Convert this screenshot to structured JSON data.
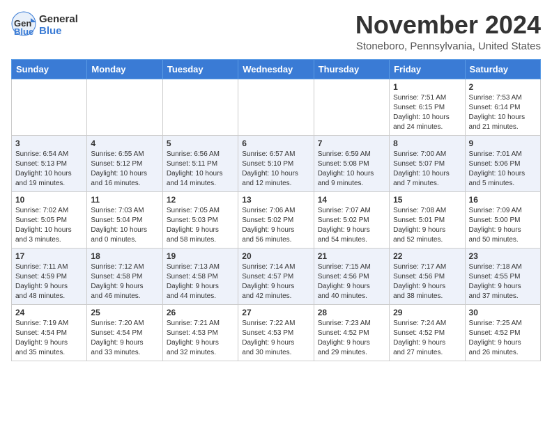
{
  "header": {
    "logo_line1": "General",
    "logo_line2": "Blue",
    "month_title": "November 2024",
    "location": "Stoneboro, Pennsylvania, United States"
  },
  "weekdays": [
    "Sunday",
    "Monday",
    "Tuesday",
    "Wednesday",
    "Thursday",
    "Friday",
    "Saturday"
  ],
  "weeks": [
    [
      {
        "day": "",
        "info": ""
      },
      {
        "day": "",
        "info": ""
      },
      {
        "day": "",
        "info": ""
      },
      {
        "day": "",
        "info": ""
      },
      {
        "day": "",
        "info": ""
      },
      {
        "day": "1",
        "info": "Sunrise: 7:51 AM\nSunset: 6:15 PM\nDaylight: 10 hours\nand 24 minutes."
      },
      {
        "day": "2",
        "info": "Sunrise: 7:53 AM\nSunset: 6:14 PM\nDaylight: 10 hours\nand 21 minutes."
      }
    ],
    [
      {
        "day": "3",
        "info": "Sunrise: 6:54 AM\nSunset: 5:13 PM\nDaylight: 10 hours\nand 19 minutes."
      },
      {
        "day": "4",
        "info": "Sunrise: 6:55 AM\nSunset: 5:12 PM\nDaylight: 10 hours\nand 16 minutes."
      },
      {
        "day": "5",
        "info": "Sunrise: 6:56 AM\nSunset: 5:11 PM\nDaylight: 10 hours\nand 14 minutes."
      },
      {
        "day": "6",
        "info": "Sunrise: 6:57 AM\nSunset: 5:10 PM\nDaylight: 10 hours\nand 12 minutes."
      },
      {
        "day": "7",
        "info": "Sunrise: 6:59 AM\nSunset: 5:08 PM\nDaylight: 10 hours\nand 9 minutes."
      },
      {
        "day": "8",
        "info": "Sunrise: 7:00 AM\nSunset: 5:07 PM\nDaylight: 10 hours\nand 7 minutes."
      },
      {
        "day": "9",
        "info": "Sunrise: 7:01 AM\nSunset: 5:06 PM\nDaylight: 10 hours\nand 5 minutes."
      }
    ],
    [
      {
        "day": "10",
        "info": "Sunrise: 7:02 AM\nSunset: 5:05 PM\nDaylight: 10 hours\nand 3 minutes."
      },
      {
        "day": "11",
        "info": "Sunrise: 7:03 AM\nSunset: 5:04 PM\nDaylight: 10 hours\nand 0 minutes."
      },
      {
        "day": "12",
        "info": "Sunrise: 7:05 AM\nSunset: 5:03 PM\nDaylight: 9 hours\nand 58 minutes."
      },
      {
        "day": "13",
        "info": "Sunrise: 7:06 AM\nSunset: 5:02 PM\nDaylight: 9 hours\nand 56 minutes."
      },
      {
        "day": "14",
        "info": "Sunrise: 7:07 AM\nSunset: 5:02 PM\nDaylight: 9 hours\nand 54 minutes."
      },
      {
        "day": "15",
        "info": "Sunrise: 7:08 AM\nSunset: 5:01 PM\nDaylight: 9 hours\nand 52 minutes."
      },
      {
        "day": "16",
        "info": "Sunrise: 7:09 AM\nSunset: 5:00 PM\nDaylight: 9 hours\nand 50 minutes."
      }
    ],
    [
      {
        "day": "17",
        "info": "Sunrise: 7:11 AM\nSunset: 4:59 PM\nDaylight: 9 hours\nand 48 minutes."
      },
      {
        "day": "18",
        "info": "Sunrise: 7:12 AM\nSunset: 4:58 PM\nDaylight: 9 hours\nand 46 minutes."
      },
      {
        "day": "19",
        "info": "Sunrise: 7:13 AM\nSunset: 4:58 PM\nDaylight: 9 hours\nand 44 minutes."
      },
      {
        "day": "20",
        "info": "Sunrise: 7:14 AM\nSunset: 4:57 PM\nDaylight: 9 hours\nand 42 minutes."
      },
      {
        "day": "21",
        "info": "Sunrise: 7:15 AM\nSunset: 4:56 PM\nDaylight: 9 hours\nand 40 minutes."
      },
      {
        "day": "22",
        "info": "Sunrise: 7:17 AM\nSunset: 4:56 PM\nDaylight: 9 hours\nand 38 minutes."
      },
      {
        "day": "23",
        "info": "Sunrise: 7:18 AM\nSunset: 4:55 PM\nDaylight: 9 hours\nand 37 minutes."
      }
    ],
    [
      {
        "day": "24",
        "info": "Sunrise: 7:19 AM\nSunset: 4:54 PM\nDaylight: 9 hours\nand 35 minutes."
      },
      {
        "day": "25",
        "info": "Sunrise: 7:20 AM\nSunset: 4:54 PM\nDaylight: 9 hours\nand 33 minutes."
      },
      {
        "day": "26",
        "info": "Sunrise: 7:21 AM\nSunset: 4:53 PM\nDaylight: 9 hours\nand 32 minutes."
      },
      {
        "day": "27",
        "info": "Sunrise: 7:22 AM\nSunset: 4:53 PM\nDaylight: 9 hours\nand 30 minutes."
      },
      {
        "day": "28",
        "info": "Sunrise: 7:23 AM\nSunset: 4:52 PM\nDaylight: 9 hours\nand 29 minutes."
      },
      {
        "day": "29",
        "info": "Sunrise: 7:24 AM\nSunset: 4:52 PM\nDaylight: 9 hours\nand 27 minutes."
      },
      {
        "day": "30",
        "info": "Sunrise: 7:25 AM\nSunset: 4:52 PM\nDaylight: 9 hours\nand 26 minutes."
      }
    ]
  ]
}
